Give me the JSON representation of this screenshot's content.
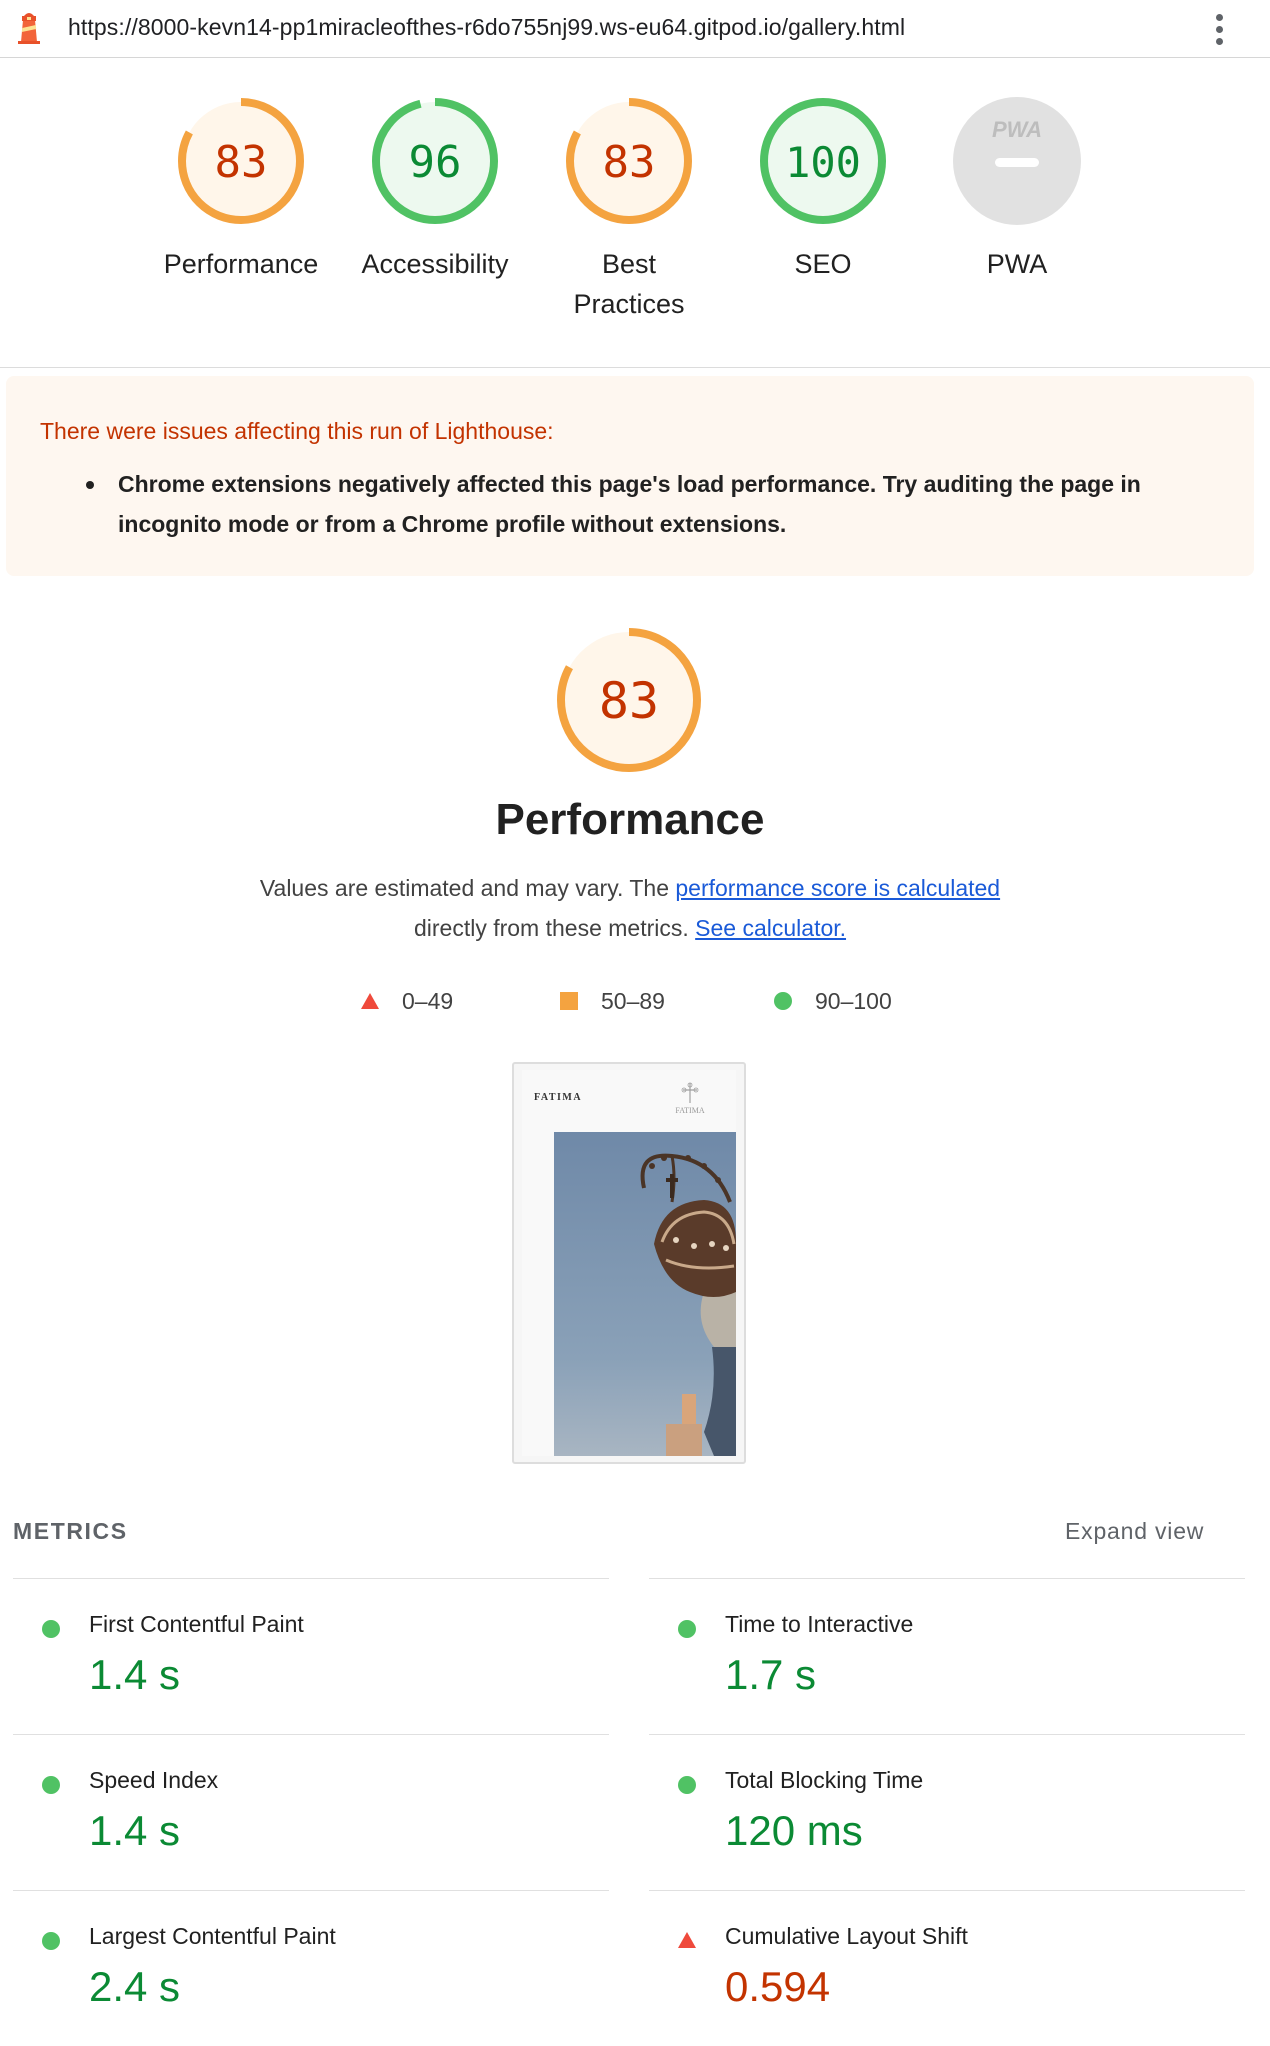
{
  "browser": {
    "url": "https://8000-kevn14-pp1miracleofthes-r6do755nj99.ws-eu64.gitpod.io/gallery.html",
    "logo_icon": "lighthouse-icon",
    "menu_icon": "kebab-menu-icon"
  },
  "colors": {
    "average": "#f4a340",
    "average_bg": "#fff6ea",
    "average_text": "#c33300",
    "pass": "#50c264",
    "pass_bg": "#edf9ef",
    "pass_text": "#0b8a34",
    "fail": "#ef4a3c",
    "link": "#1a5ad8",
    "na": "#e1e1e1"
  },
  "scores": [
    {
      "id": "performance",
      "score": "83",
      "label": "Performance",
      "rating": "average"
    },
    {
      "id": "accessibility",
      "score": "96",
      "label": "Accessibility",
      "rating": "pass"
    },
    {
      "id": "best-practices",
      "score": "83",
      "label": "Best Practices",
      "rating": "average"
    },
    {
      "id": "seo",
      "score": "100",
      "label": "SEO",
      "rating": "pass"
    },
    {
      "id": "pwa",
      "score": "PWA",
      "label": "PWA",
      "rating": "na"
    }
  ],
  "warning": {
    "title": "There were issues affecting this run of Lighthouse:",
    "items": [
      "Chrome extensions negatively affected this page's load performance. Try auditing the page in incognito mode or from a Chrome profile without extensions."
    ]
  },
  "performance": {
    "score": "83",
    "title": "Performance",
    "desc_prefix": "Values are estimated and may vary. The",
    "desc_link": "performance score is calculated",
    "desc_middle": "directly from these metrics.",
    "calc_link": "See calculator.",
    "legend": [
      {
        "shape": "triangle-icon",
        "range": "0–49"
      },
      {
        "shape": "square-icon",
        "range": "50–89"
      },
      {
        "shape": "circle-icon",
        "range": "90–100"
      }
    ]
  },
  "screenshot": {
    "brand": "FATIMA",
    "emblem_text": "FATIMA",
    "emblem_icon": "cross-emblem-icon",
    "photo": "crown-statue-photo"
  },
  "metrics": {
    "header": "METRICS",
    "expand": "Expand view",
    "items": [
      {
        "title": "First Contentful Paint",
        "value": "1.4 s",
        "rating": "pass"
      },
      {
        "title": "Time to Interactive",
        "value": "1.7 s",
        "rating": "pass"
      },
      {
        "title": "Speed Index",
        "value": "1.4 s",
        "rating": "pass"
      },
      {
        "title": "Total Blocking Time",
        "value": "120 ms",
        "rating": "pass"
      },
      {
        "title": "Largest Contentful Paint",
        "value": "2.4 s",
        "rating": "pass"
      },
      {
        "title": "Cumulative Layout Shift",
        "value": "0.594",
        "rating": "fail"
      }
    ]
  }
}
